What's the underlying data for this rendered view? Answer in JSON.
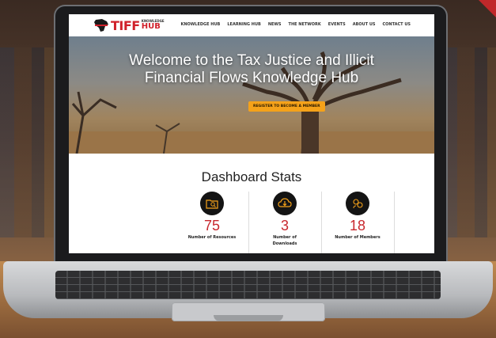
{
  "nav": {
    "logo_main": "TIFF",
    "logo_kn": "KNOWLEDGE",
    "logo_hub": "HUB",
    "items": [
      "KNOWLEDGE HUB",
      "LEARNING HUB",
      "NEWS",
      "THE NETWORK",
      "EVENTS",
      "ABOUT US",
      "CONTACT US"
    ]
  },
  "hero": {
    "title_line1": "Welcome to the Tax Justice and Illicit",
    "title_line2": "Financial Flows Knowledge Hub",
    "cta": "REGISTER TO BECOME A MEMBER"
  },
  "stats": {
    "title": "Dashboard Stats",
    "items": [
      {
        "value": "75",
        "label": "Number of Resources",
        "icon": "folder-search-icon"
      },
      {
        "value": "3",
        "label": "Number of Downloads",
        "icon": "cloud-download-icon"
      },
      {
        "value": "18",
        "label": "Number of Members",
        "icon": "members-icon"
      }
    ]
  },
  "colors": {
    "brand_red": "#d0202a",
    "accent_orange": "#f5a21a",
    "stat_number": "#c8282e",
    "icon_bg": "#141414"
  }
}
